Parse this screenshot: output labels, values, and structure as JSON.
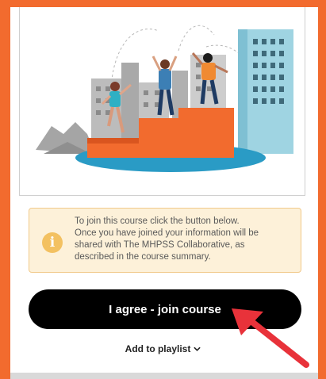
{
  "course_card": {
    "illustration": {
      "icon": "community-rebuilding-illustration",
      "colors": {
        "orange": "#f26b2e",
        "water": "#2a9bc5",
        "building": "#9fd4e2"
      }
    },
    "notice": {
      "icon": "info-icon",
      "icon_glyph": "i",
      "lines": [
        "To join this course click the button below.",
        "Once you have joined your information will be",
        "shared with The MHPSS Collaborative, as",
        "described in the course summary."
      ],
      "colors": {
        "background": "#fdf1d9",
        "border": "#f1c98a"
      }
    },
    "join_button": {
      "label": "I agree - join course"
    },
    "playlist": {
      "label": "Add to playlist",
      "icon": "chevron-down-icon"
    }
  },
  "annotation": {
    "icon": "red-arrow-icon",
    "color": "#e8323a"
  },
  "frame": {
    "accent_color": "#f26b2e"
  }
}
